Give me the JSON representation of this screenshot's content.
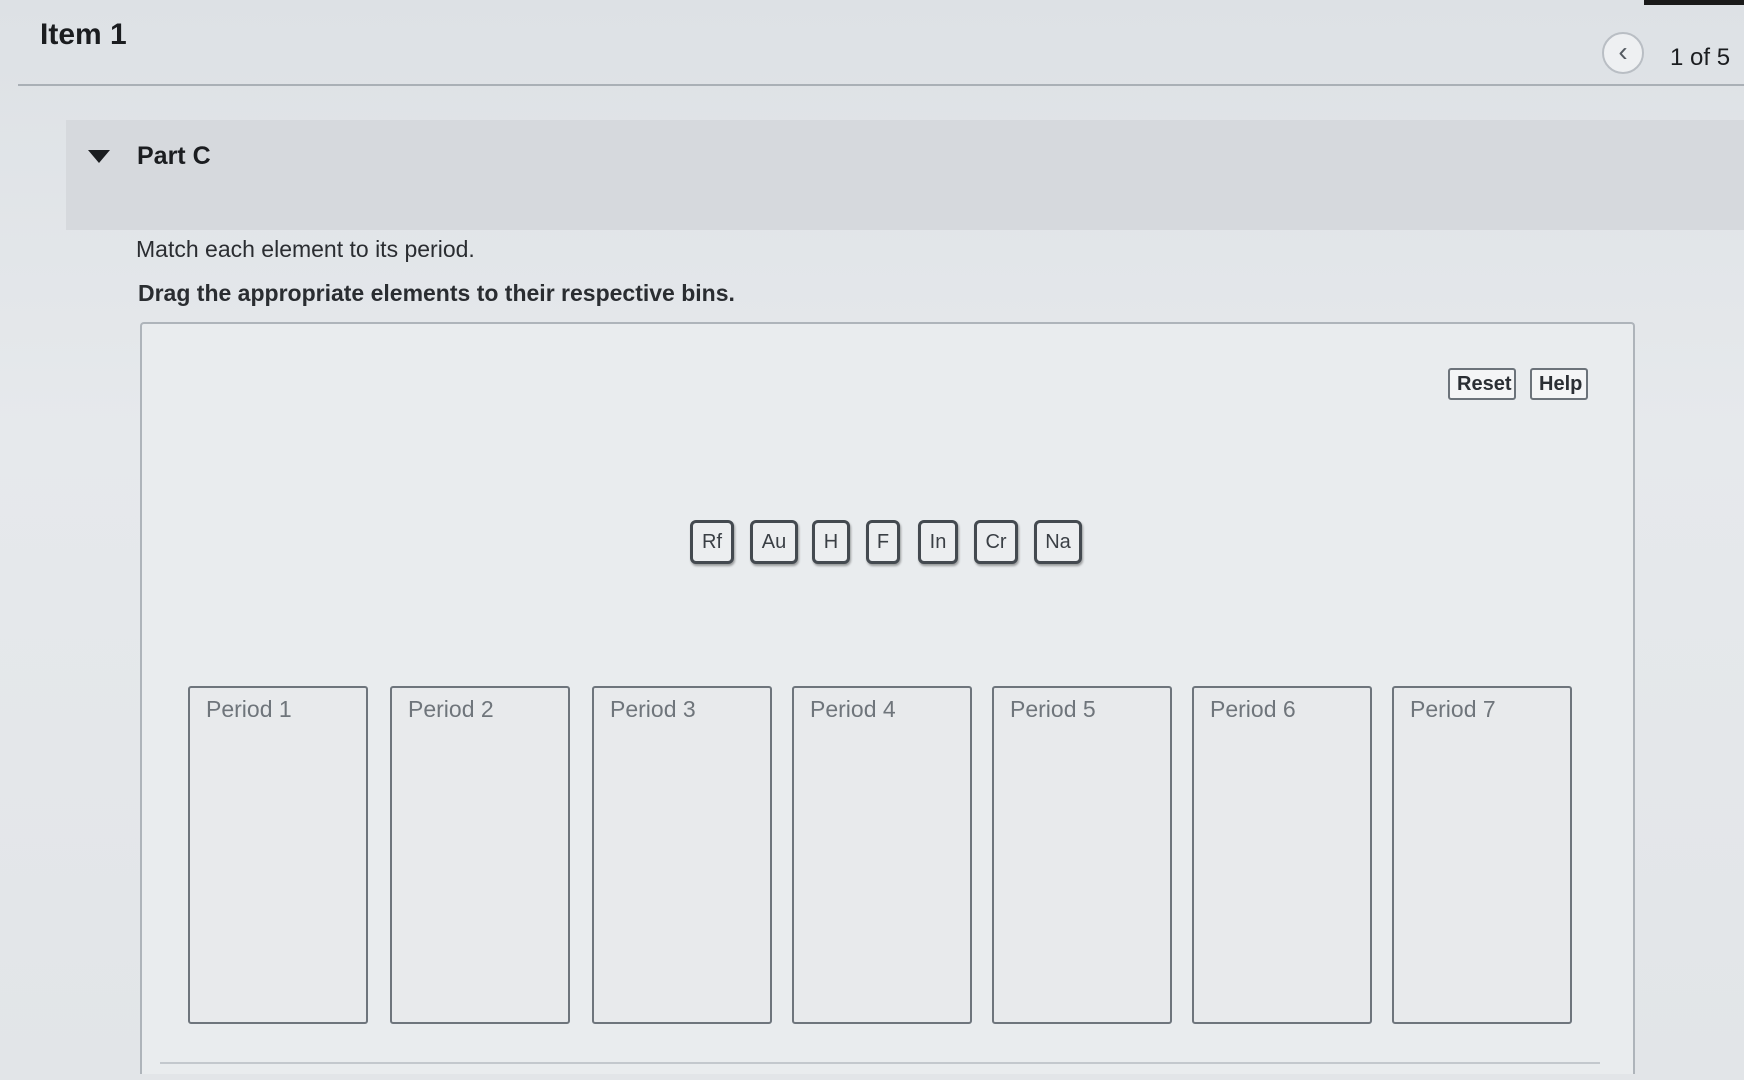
{
  "header": {
    "item_title": "Item 1",
    "pager": "1 of 5",
    "prev_icon": "chevron-left-icon"
  },
  "part": {
    "title": "Part C",
    "toggle_icon": "caret-down-icon",
    "instruction_1": "Match each element to its period.",
    "instruction_2": "Drag the appropriate elements to their respective bins."
  },
  "toolbar": {
    "reset_label": "Reset",
    "help_label": "Help"
  },
  "tokens": [
    "Rf",
    "Au",
    "H",
    "F",
    "In",
    "Cr",
    "Na"
  ],
  "bins": [
    "Period 1",
    "Period 2",
    "Period 3",
    "Period 4",
    "Period 5",
    "Period 6",
    "Period 7"
  ]
}
